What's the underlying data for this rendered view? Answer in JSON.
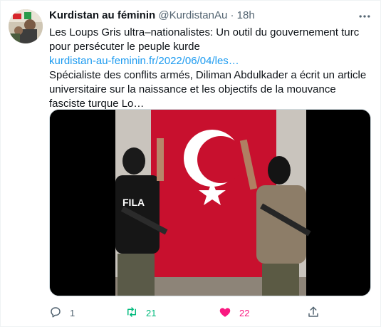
{
  "tweet": {
    "display_name": "Kurdistan au féminin",
    "handle": "@KurdistanAu",
    "separator": "·",
    "time": "18h",
    "line1": "Les Loups Gris ultra–nationalistes: Un outil du gouvernement turc pour persécuter le peuple kurde",
    "link": "kurdistan-au-feminin.fr/2022/06/04/les…",
    "line2": "Spécialiste des conflits armés, Diliman Abdulkader a écrit un article universitaire sur la naissance et les objectifs de la mouvance fasciste turque Lo…"
  },
  "media": {
    "flag_color": "#c8102e",
    "shirt_text": "FILA"
  },
  "actions": {
    "reply_count": "1",
    "retweet_count": "21",
    "like_count": "22",
    "reply_icon": "reply-icon",
    "retweet_icon": "retweet-icon",
    "like_icon": "heart-icon",
    "share_icon": "share-icon"
  },
  "colors": {
    "accent": "#1d9bf0",
    "retweet": "#00ba7c",
    "like": "#f91880",
    "muted": "#536471"
  }
}
